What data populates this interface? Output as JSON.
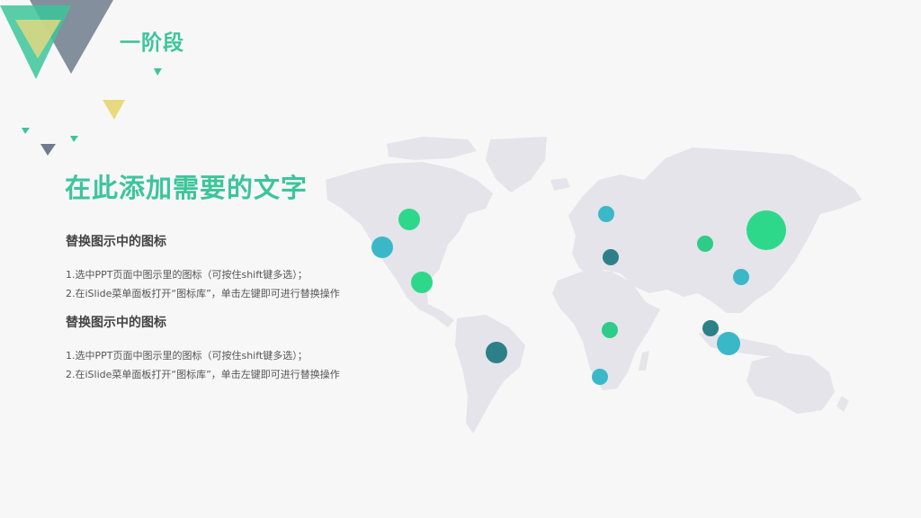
{
  "header": {
    "title": "一阶段"
  },
  "main": {
    "title": "在此添加需要的文字",
    "sections": [
      {
        "subtitle": "替换图示中的图标",
        "lines": [
          "1.选中PPT页面中图示里的图标（可按住shift键多选）；",
          "2.在iSlide菜单面板打开“图标库”，单击左键即可进行替换操作"
        ]
      },
      {
        "subtitle": "替换图示中的图标",
        "lines": [
          "1.选中PPT页面中图示里的图标（可按住shift键多选）；",
          "2.在iSlide菜单面板打开“图标库”，单击左键即可进行替换操作"
        ]
      }
    ]
  },
  "colors": {
    "accent": "#3cc59a",
    "green": "#2ed88a",
    "teal": "#3bb8c8",
    "dark_teal": "#2e8088",
    "map_gray": "#e4e4ea",
    "slate": "#6f7c8c",
    "yellow": "#e8d97e"
  },
  "map": {
    "markers": [
      "green",
      "teal",
      "green",
      "dark_teal",
      "teal",
      "dark_teal",
      "green",
      "teal",
      "green",
      "teal",
      "green",
      "teal",
      "dark_teal",
      "teal"
    ]
  }
}
